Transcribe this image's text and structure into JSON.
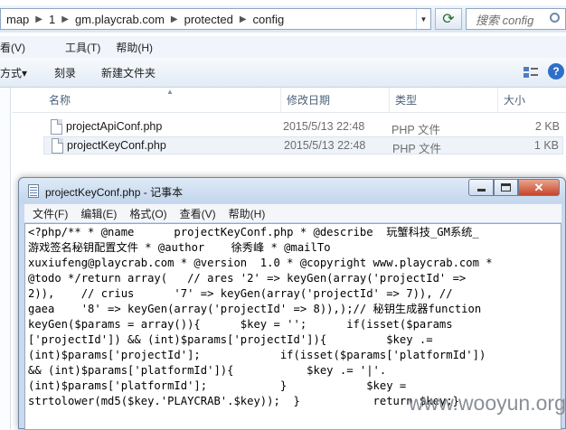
{
  "explorer": {
    "breadcrumbs": [
      "map",
      "1",
      "gm.playcrab.com",
      "protected",
      "config"
    ],
    "search_placeholder": "搜索 config",
    "menu": [
      "看(V)",
      "工具(T)",
      "帮助(H)"
    ],
    "toolbar": {
      "organize_label": "方式▾",
      "burn_label": "刻录",
      "new_folder_label": "新建文件夹"
    },
    "columns": {
      "name": "名称",
      "modified": "修改日期",
      "type": "类型",
      "size": "大小"
    },
    "files": [
      {
        "name": "projectApiConf.php",
        "modified": "2015/5/13 22:48",
        "type": "PHP 文件",
        "size": "2 KB"
      },
      {
        "name": "projectKeyConf.php",
        "modified": "2015/5/13 22:48",
        "type": "PHP 文件",
        "size": "1 KB"
      }
    ],
    "icons": {
      "refresh": "refresh-icon",
      "search": "search-icon",
      "help": "help-icon",
      "views": "views-icon"
    }
  },
  "notepad": {
    "title": "projectKeyConf.php - 记事本",
    "menu": [
      "文件(F)",
      "编辑(E)",
      "格式(O)",
      "查看(V)",
      "帮助(H)"
    ],
    "lines": [
      "<?php/** * @name      projectKeyConf.php * @describe  玩蟹科技_GM系统_",
      "游戏签名秘钥配置文件 * @author    徐秀峰 * @mailTo",
      "xuxiufeng@playcrab.com * @version  1.0 * @copyright www.playcrab.com *",
      "@todo */return array(   // ares '2' => keyGen(array('projectId' =>",
      "2)),    // crius      '7' => keyGen(array('projectId' => 7)), //",
      "gaea    '8' => keyGen(array('projectId' => 8)),);// 秘钥生成器function",
      "keyGen($params = array()){      $key = '';      if(isset($params",
      "['projectId']) && (int)$params['projectId']){         $key .=",
      "(int)$params['projectId'];            if(isset($params['platformId'])",
      "&& (int)$params['platformId']){           $key .= '|'.",
      "(int)$params['platformId'];           }            $key =",
      "strtolower(md5($key.'PLAYCRAB'.$key));  }           return $key;}"
    ]
  },
  "watermark": "www.wooyun.org"
}
